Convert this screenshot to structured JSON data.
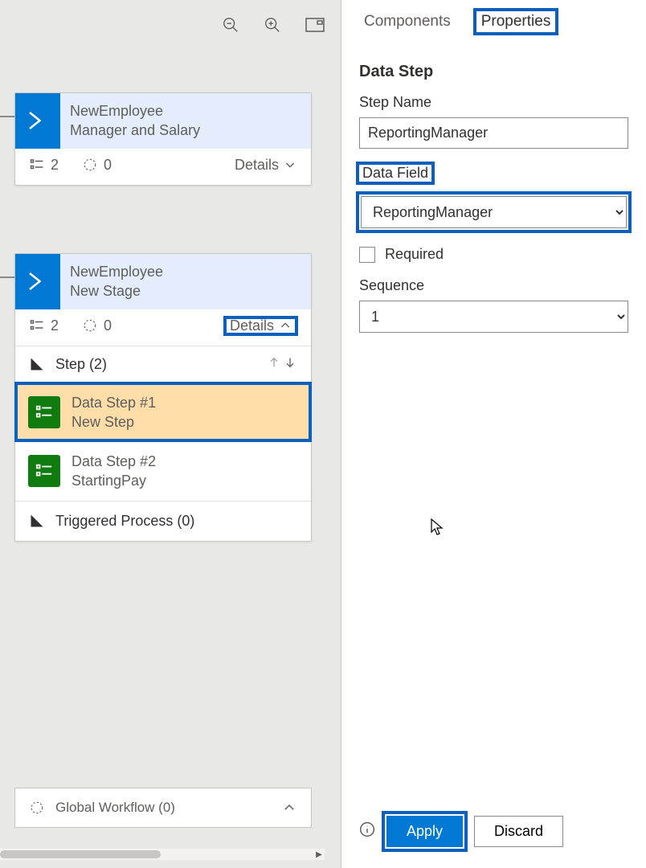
{
  "toolbar": {
    "zoom_out": "zoom-out-icon",
    "zoom_in": "zoom-in-icon",
    "fit": "fit-to-screen-icon"
  },
  "stages": [
    {
      "entity": "NewEmployee",
      "name": "Manager and Salary",
      "steps_count": "2",
      "processes_count": "0",
      "details_label": "Details"
    },
    {
      "entity": "NewEmployee",
      "name": "New Stage",
      "steps_count": "2",
      "processes_count": "0",
      "details_label": "Details",
      "step_header": "Step (2)",
      "steps": [
        {
          "title": "Data Step #1",
          "subtitle": "New Step"
        },
        {
          "title": "Data Step #2",
          "subtitle": "StartingPay"
        }
      ],
      "triggered_label": "Triggered Process (0)"
    }
  ],
  "global_workflow_label": "Global Workflow (0)",
  "tabs": {
    "components": "Components",
    "properties": "Properties"
  },
  "properties": {
    "section_title": "Data Step",
    "step_name_label": "Step Name",
    "step_name_value": "ReportingManager",
    "data_field_label": "Data Field",
    "data_field_value": "ReportingManager",
    "required_label": "Required",
    "sequence_label": "Sequence",
    "sequence_value": "1"
  },
  "footer": {
    "apply_label": "Apply",
    "discard_label": "Discard"
  }
}
